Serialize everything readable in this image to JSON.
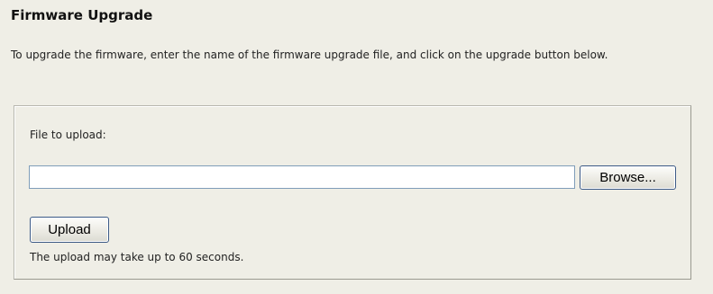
{
  "page": {
    "title": "Firmware Upgrade",
    "intro": "To upgrade the firmware, enter the name of the firmware upgrade file, and click on the upgrade button below."
  },
  "upload_panel": {
    "file_label": "File to upload:",
    "file_input_value": "",
    "browse_label": "Browse...",
    "upload_label": "Upload",
    "note": "The upload may take up to 60 seconds."
  },
  "colors": {
    "background": "#efeee6",
    "input_border": "#7f9db9",
    "button_border": "#3c5a86"
  }
}
